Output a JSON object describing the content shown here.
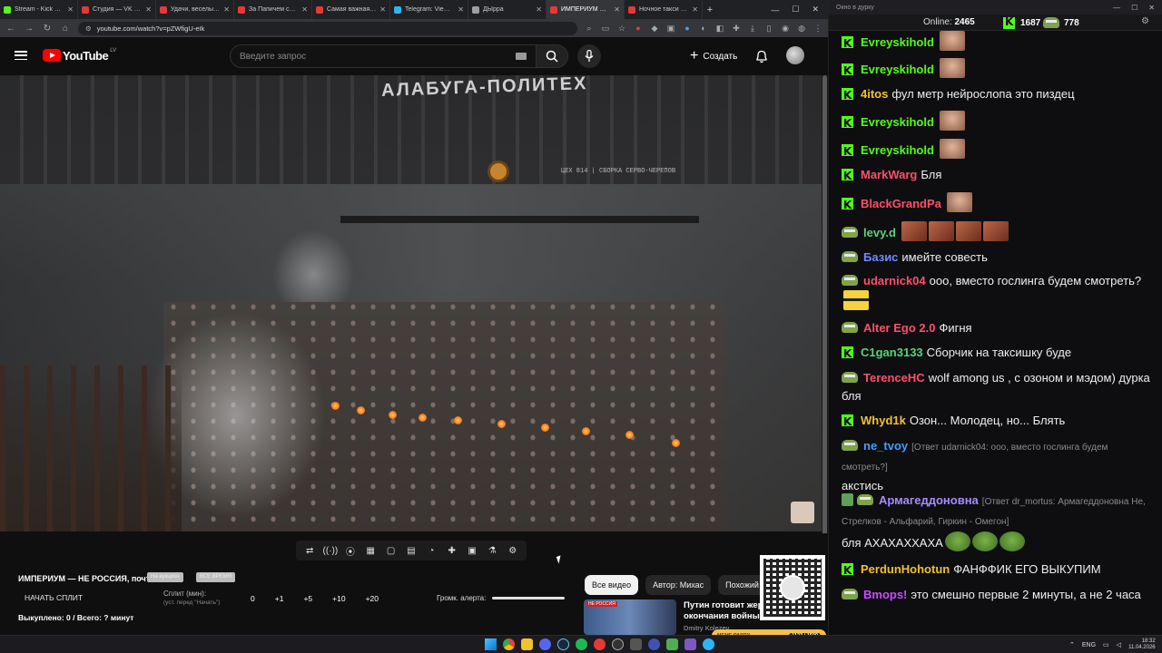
{
  "browser": {
    "tabs": [
      {
        "label": "Stream - Kick Dashb...",
        "color": "#53fc18",
        "active": false
      },
      {
        "label": "Студия — VK Видео",
        "color": "#e53935",
        "active": false
      },
      {
        "label": "Удачи, веселых, жо...",
        "color": "#e53935",
        "active": false
      },
      {
        "label": "За Папичем следу...",
        "color": "#e53935",
        "active": false
      },
      {
        "label": "Самая важная мо...",
        "color": "#e53935",
        "active": false
      },
      {
        "label": "Telegram: View @...",
        "color": "#29b6f6",
        "active": false
      },
      {
        "label": "ДЫрра",
        "color": "#9e9e9e",
        "active": false
      },
      {
        "label": "ИМПЕРИУМ — Н...",
        "color": "#e53935",
        "active": true
      },
      {
        "label": "Ночное такси (202...",
        "color": "#e53935",
        "active": false
      }
    ],
    "url": "youtube.com/watch?v=pZWfigU-eIk"
  },
  "yt": {
    "logo": "YouTube",
    "logo_region": "LV",
    "search_placeholder": "Введите запрос",
    "create_label": "Создать"
  },
  "video": {
    "banner": "АЛАБУГА-ПОЛИТЕХ",
    "sign": "ЦЕХ 814 | СБОРКА СЕРВО-ЧЕРЕПОВ"
  },
  "toolbar_icons": [
    "loop-icon",
    "broadcast-icon",
    "record-icon",
    "clapper-icon",
    "pip-icon",
    "subtitles-icon",
    "speed-icon",
    "ai-icon",
    "camera-icon",
    "flask-icon",
    "settings-icon"
  ],
  "below": {
    "title": "ИМПЕРИУМ — НЕ РОССИЯ, почти",
    "chip1": "На аукцион",
    "chip2": "ВСЕ ВРЕМЯ",
    "start_split": "НАЧАТЬ СПЛИТ",
    "split_label": "Сплит (мин):",
    "split_sub": "(уст. перед \"Начать\")",
    "split_values": [
      "0",
      "+1",
      "+5",
      "+10",
      "+20"
    ],
    "volume_label": "Громк. алерта:",
    "bought": "Выкуплено: 0 / Всего: ? минут",
    "pills": [
      "Все видео",
      "Автор: Михас",
      "Похожий ко"
    ],
    "rec_badge": "НЕ РОССИЯ",
    "rec_title": "Путин готовит жерт",
    "rec_title2": "окончания войны?",
    "rec_channel": "Dmitry Kolezev",
    "meme_label": "MEME PARTY",
    "meme_count": "1123 / 1500"
  },
  "chat": {
    "window_title": "Окно в дурку",
    "online_label": "Online:",
    "online_count": "2465",
    "kick_count": "1687",
    "viewers2": "778",
    "messages": [
      {
        "badge": "kick",
        "user": "Evreyskihold",
        "color": "#53fc18",
        "text": "",
        "emotes": [
          "face"
        ]
      },
      {
        "badge": "kick",
        "user": "Evreyskihold",
        "color": "#53fc18",
        "text": "",
        "emotes": [
          "face"
        ]
      },
      {
        "badge": "kick",
        "user": "4itos",
        "color": "#f2c12e",
        "text": "фул метр нейрослопа это пиздец",
        "emotes": []
      },
      {
        "badge": "kick",
        "user": "Evreyskihold",
        "color": "#53fc18",
        "text": "",
        "emotes": [
          "face"
        ]
      },
      {
        "badge": "kick",
        "user": "Evreyskihold",
        "color": "#53fc18",
        "text": "",
        "emotes": [
          "face"
        ]
      },
      {
        "badge": "kick",
        "user": "MarkWarg",
        "color": "#ff4f6a",
        "text": "Бля",
        "emotes": []
      },
      {
        "badge": "kick",
        "user": "BlackGrandPa",
        "color": "#ff4f6a",
        "text": "",
        "emotes": [
          "face"
        ]
      },
      {
        "badge": "pepe",
        "user": "levy.d",
        "color": "#58d37a",
        "text": "",
        "emotes": [
          "plain",
          "plain",
          "plain",
          "plain"
        ]
      },
      {
        "badge": "pepe",
        "user": "Базис",
        "color": "#6b8cff",
        "text": "имейте совесть",
        "emotes": []
      },
      {
        "badge": "pepe",
        "user": "udarnick04",
        "color": "#ff4f6a",
        "text": "ооо, вместо гослинга будем смотреть?",
        "emotes": [
          "bee"
        ]
      },
      {
        "badge": "pepe",
        "user": "Alter Ego 2.0",
        "color": "#ff4f6a",
        "text": "Фигня",
        "emotes": []
      },
      {
        "badge": "kick",
        "user": "C1gan3133",
        "color": "#58d37a",
        "text": "Сборчик на таксишку буде",
        "emotes": []
      },
      {
        "badge": "pepe",
        "user": "TerenceHC",
        "color": "#ff4f6a",
        "text": "wolf among us , с озоном и мэдом) дурка бля",
        "emotes": []
      },
      {
        "badge": "kick",
        "user": "Whyd1k",
        "color": "#f2c12e",
        "text": "Озон... Молодец, но... Блять",
        "emotes": []
      },
      {
        "badge": "pepe",
        "user": "ne_tvoy",
        "color": "#3fa0ff",
        "reply": "[Ответ udarnick04: ооо, вместо гослинга будем смотреть?]",
        "text": "акстись",
        "emotes": []
      },
      {
        "badge": "pepe2",
        "user": "Армагеддоновна",
        "color": "#a78bff",
        "reply": "[Ответ dr_mortus: Армагеддоновна Не, Стрелков - Альфарий, Гиркин - Омегон]",
        "text": "бля АХАХАХХАХА",
        "emotes": [
          "pepe",
          "pepe",
          "pepe"
        ]
      },
      {
        "badge": "kick",
        "user": "PerdunHohotun",
        "color": "#f2c12e",
        "text": "ФАНФФИК ЕГО ВЫКУПИМ",
        "emotes": []
      },
      {
        "badge": "pepe",
        "user": "Bmops!",
        "color": "#c84bff",
        "text": "это смешно первые 2 минуты, а не 2 часа",
        "emotes": []
      }
    ]
  },
  "taskbar": {
    "lang": "ENG",
    "time": "18:32",
    "date": "11.04.2026"
  }
}
